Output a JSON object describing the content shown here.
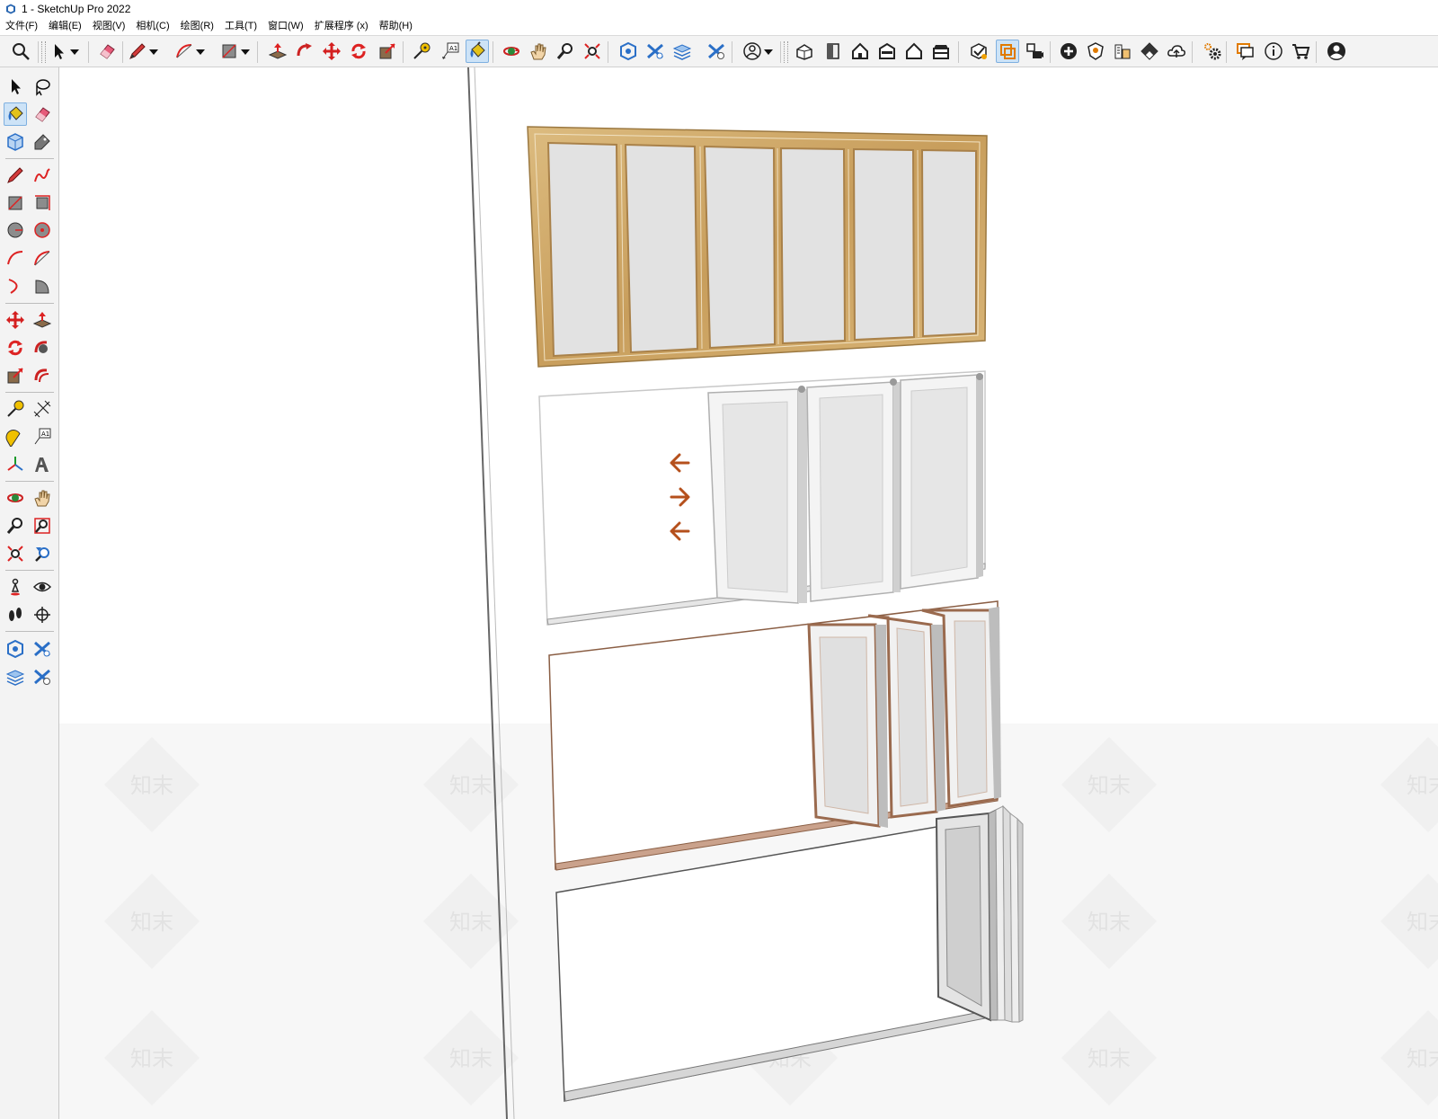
{
  "window": {
    "title": "1 - SketchUp Pro 2022"
  },
  "menu": {
    "file": "文件(F)",
    "edit": "编辑(E)",
    "view": "视图(V)",
    "camera": "相机(C)",
    "draw": "绘图(R)",
    "tools": "工具(T)",
    "window": "窗口(W)",
    "extensions": "扩展程序 (x)",
    "help": "帮助(H)"
  },
  "toolbar": {
    "active_tool": "paint-bucket"
  },
  "left_toolbar": {
    "active_tool": "paint-bucket"
  },
  "viewport": {
    "watermark_text": "知末",
    "colors": {
      "wood": "#d3ad6e",
      "wood_dark": "#a98149",
      "glass": "#e2e2e2",
      "white_frame": "#f4f4f4",
      "brown_frame": "#9a6a4e",
      "arrow": "#b5501c",
      "ground": "#f7f7f7"
    }
  }
}
